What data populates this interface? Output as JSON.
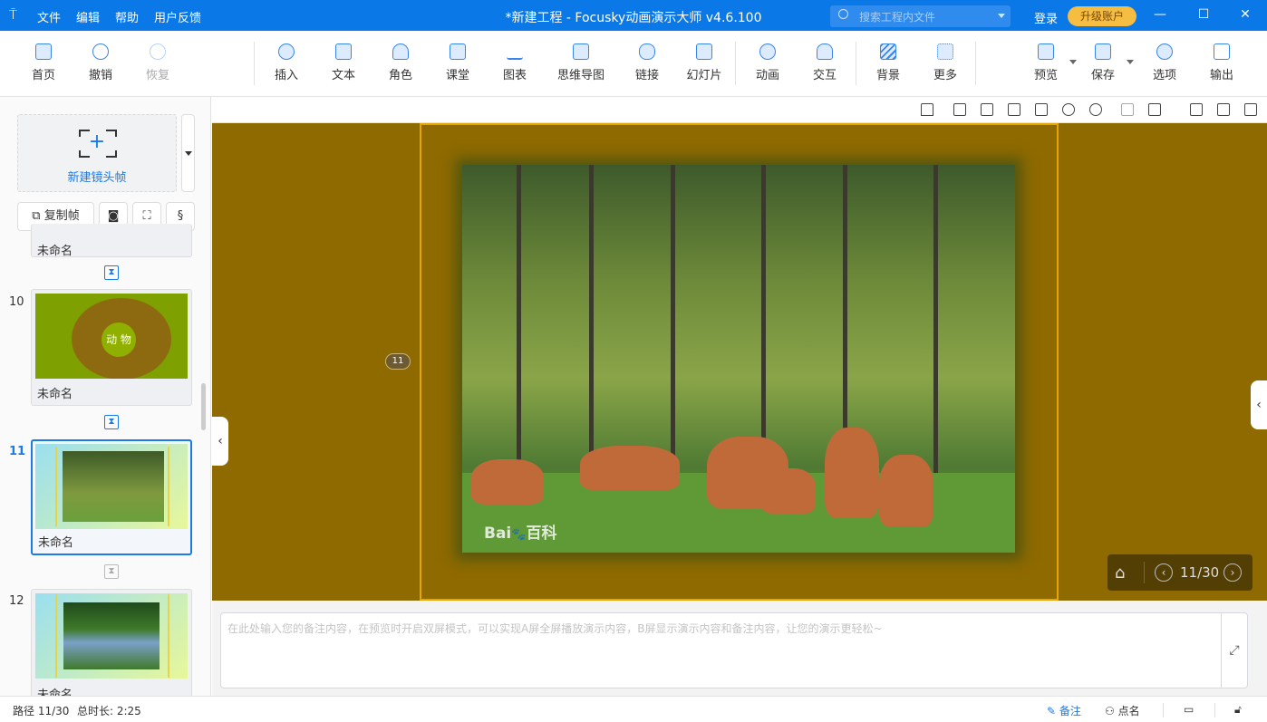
{
  "titlebar": {
    "logo_icon": "presentation-icon",
    "menu": [
      "文件",
      "编辑",
      "帮助",
      "用户反馈"
    ],
    "title": "*新建工程 - Focusky动画演示大师  v4.6.100",
    "search_placeholder": "搜索工程内文件",
    "login": "登录",
    "upgrade": "升级账户"
  },
  "toolbar": {
    "home": "首页",
    "undo": "撤销",
    "redo": "恢复",
    "insert": "插入",
    "text": "文本",
    "role": "角色",
    "class": "课堂",
    "chart": "图表",
    "mindmap": "思维导图",
    "link": "链接",
    "slide": "幻灯片",
    "animation": "动画",
    "interact": "交互",
    "background": "背景",
    "more": "更多",
    "preview": "预览",
    "save": "保存",
    "options": "选项",
    "export": "输出"
  },
  "sidebar": {
    "new_frame": "新建镜头帧",
    "copy_frame": "复制帧",
    "items": [
      {
        "num": "",
        "name": "未命名"
      },
      {
        "num": "10",
        "name": "未命名",
        "thumb_text": "动 物"
      },
      {
        "num": "11",
        "name": "未命名",
        "selected": true
      },
      {
        "num": "12",
        "name": "未命名"
      }
    ]
  },
  "canvas": {
    "bg_color": "#8f6a00",
    "frame_color": "#e6a500",
    "frame_badge": "11",
    "watermark": "Bai百科",
    "nav_page": "11/30"
  },
  "notes": {
    "placeholder": "在此处输入您的备注内容，在预览时开启双屏模式，可以实现A屏全屏播放演示内容，B屏显示演示内容和备注内容，让您的演示更轻松~"
  },
  "status": {
    "path": "路径 11/30",
    "duration": "总时长: 2:25",
    "notes": "备注",
    "rollcall": "点名"
  },
  "colors": {
    "accent": "#0b78e8",
    "upgrade": "#f5bd41"
  }
}
